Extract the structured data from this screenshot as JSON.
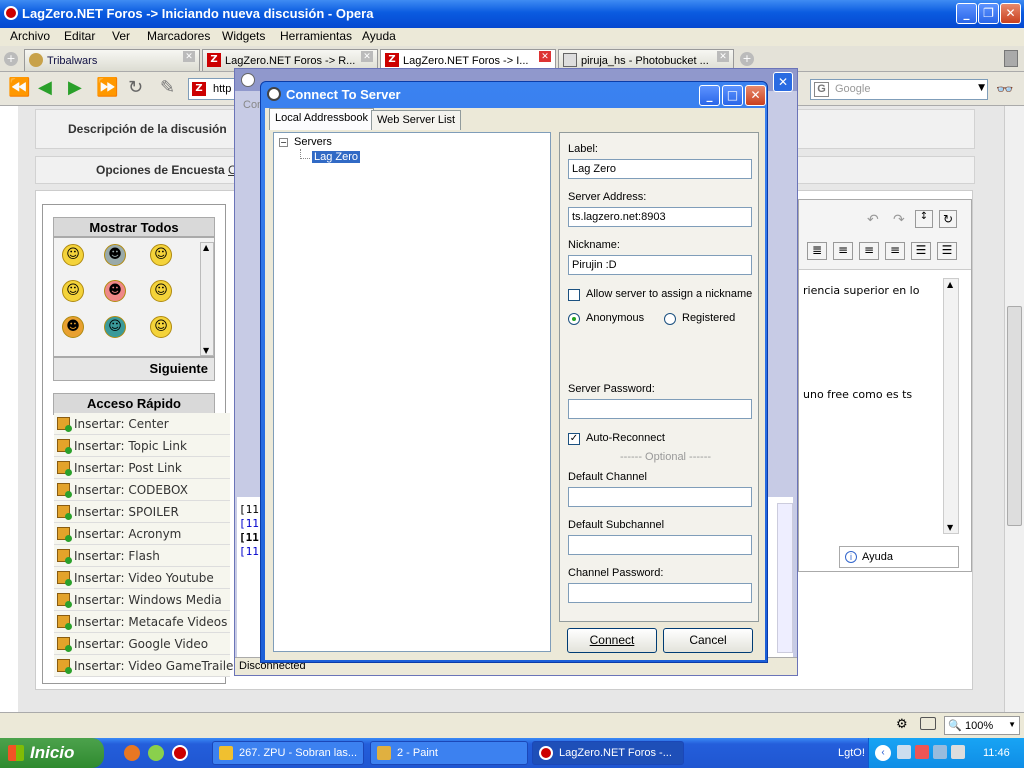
{
  "window": {
    "title": "LagZero.NET Foros -> Iniciando nueva discusión - Opera"
  },
  "menu": [
    "Archivo",
    "Editar",
    "Ver",
    "Marcadores",
    "Widgets",
    "Herramientas",
    "Ayuda"
  ],
  "tabs": [
    {
      "label": "Tribalwars"
    },
    {
      "label": "LagZero.NET Foros -> R..."
    },
    {
      "label": "LagZero.NET Foros -> I..."
    },
    {
      "label": "piruja_hs - Photobucket ..."
    }
  ],
  "address": {
    "value": "http"
  },
  "search": {
    "placeholder": "Google"
  },
  "page": {
    "row1_label": "Descripción de la discusión",
    "row2_label": "Opciones de Encuesta",
    "row2_link": "C",
    "smilies_header": "Mostrar Todos",
    "smilies_next": "Siguiente",
    "quick_header": "Acceso Rápido",
    "quick_items": [
      "Insertar: Center",
      "Insertar: Topic Link",
      "Insertar: Post Link",
      "Insertar: CODEBOX",
      "Insertar: SPOILER",
      "Insertar: Acronym",
      "Insertar: Flash",
      "Insertar: Video Youtube",
      "Insertar: Windows Media",
      "Insertar: Metacafe Videos",
      "Insertar: Google Video",
      "Insertar: Video GameTrailers"
    ],
    "editor_text_1": "riencia superior en lo",
    "editor_text_2": "uno free como es ts",
    "help_button": "Ayuda",
    "bg_status": "Disconnected",
    "bg_tab": "Con"
  },
  "log_lines": [
    "[11:",
    "[11:",
    "[11:",
    "[11:"
  ],
  "dialog": {
    "title": "Connect To Server",
    "tabs": [
      "Local Addressbook",
      "Web Server List"
    ],
    "tree_root": "Servers",
    "tree_child": "Lag Zero",
    "label_caption": "Label:",
    "label_value": "Lag Zero",
    "address_caption": "Server Address:",
    "address_value": "ts.lagzero.net:8903",
    "nickname_caption": "Nickname:",
    "nickname_value": "Pirujin :D",
    "allow_nick_label": "Allow server to assign a nickname",
    "anonymous_label": "Anonymous",
    "registered_label": "Registered",
    "password_caption": "Server Password:",
    "auto_reconnect_label": "Auto-Reconnect",
    "optional_label": "------ Optional ------",
    "default_channel_caption": "Default Channel",
    "default_subchannel_caption": "Default Subchannel",
    "channel_password_caption": "Channel Password:",
    "connect_button": "Connect",
    "cancel_button": "Cancel"
  },
  "statusbar": {
    "zoom": "100%"
  },
  "taskbar": {
    "start": "Inicio",
    "buttons": [
      "267. ZPU - Sobran las...",
      "2 - Paint",
      "LagZero.NET Foros -..."
    ],
    "tray_label": "LgtO!",
    "clock": "11:46"
  },
  "colors": {
    "xp_blue": "#245edb",
    "dialog_body": "#ece9d8",
    "opera_red": "#cc0000"
  }
}
